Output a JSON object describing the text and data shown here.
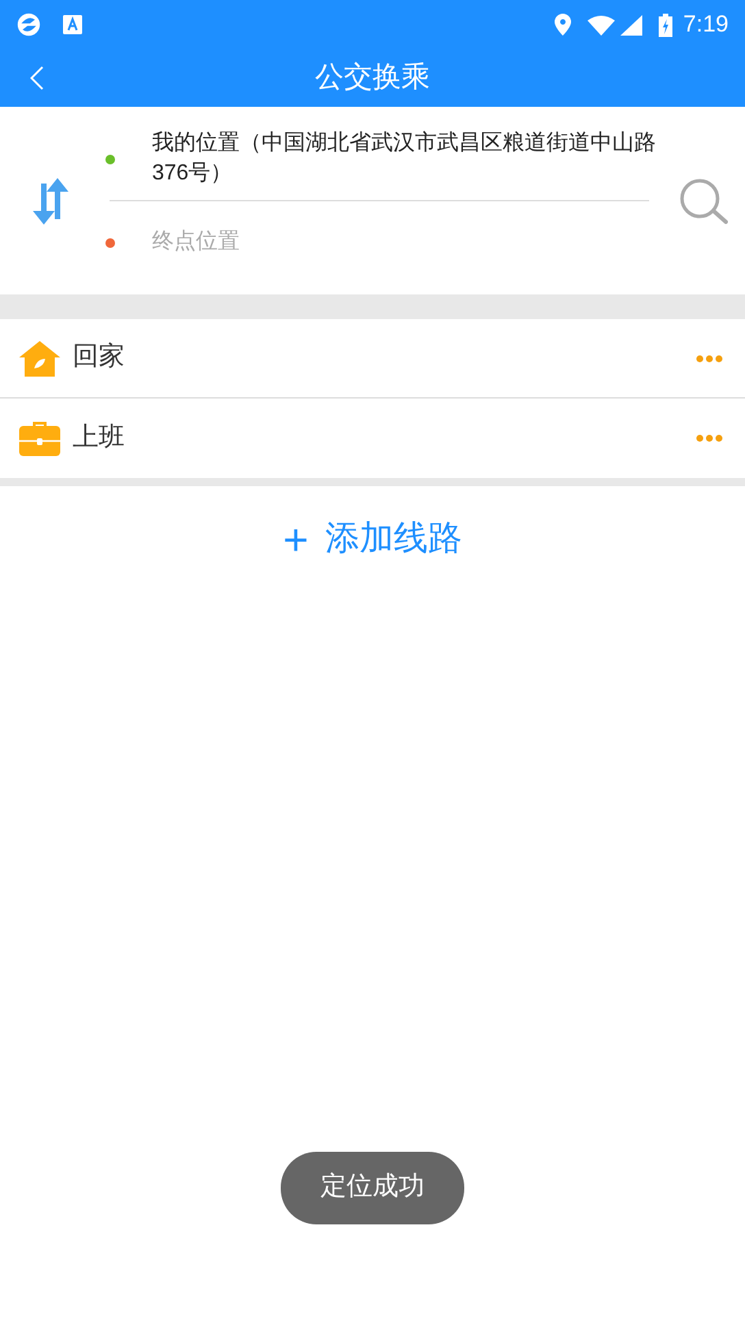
{
  "status_bar": {
    "time": "7:19"
  },
  "header": {
    "title": "公交换乘"
  },
  "stops": [
    {
      "kind": "start",
      "value": "我的位置（中国湖北省武汉市武昌区粮道街道中山路376号）",
      "color": "#6abf2a"
    },
    {
      "kind": "end",
      "placeholder": "终点位置",
      "color": "#f0673a"
    }
  ],
  "routes": [
    {
      "kind": "home",
      "label": "回家"
    },
    {
      "kind": "work",
      "label": "上班"
    }
  ],
  "add_route": {
    "icon": "+",
    "label": "添加线路"
  },
  "toast": "定位成功"
}
